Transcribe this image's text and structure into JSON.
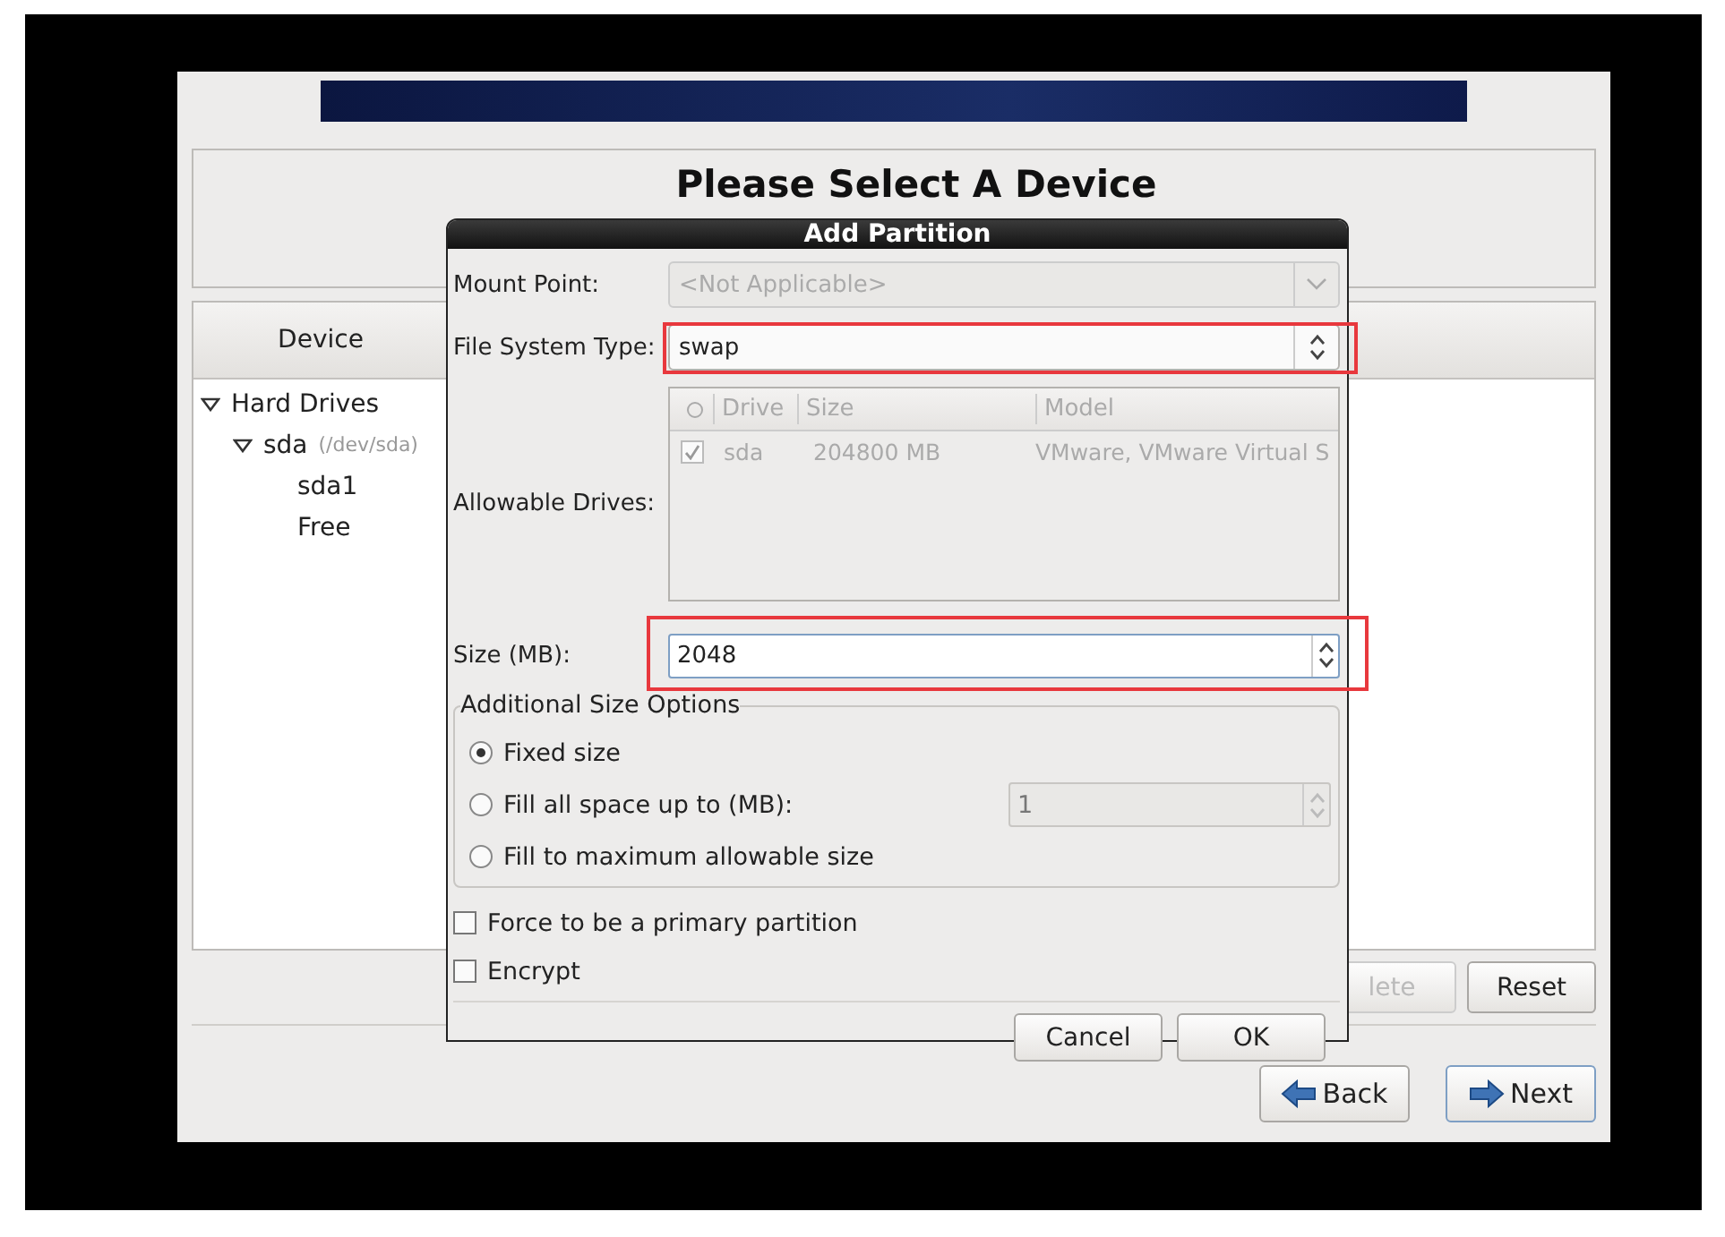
{
  "installer": {
    "heading": "Please Select A Device",
    "device_panel": {
      "column_header": "Device",
      "tree": [
        {
          "label": "Hard Drives",
          "expanded": true,
          "children": [
            {
              "label": "sda",
              "detail": "(/dev/sda)",
              "expanded": true,
              "children": [
                {
                  "label": "sda1"
                },
                {
                  "label": "Free"
                }
              ]
            }
          ]
        }
      ]
    },
    "panel_buttons": [
      {
        "label": "lete",
        "disabled": true
      },
      {
        "label": "Reset",
        "disabled": false
      }
    ],
    "nav_buttons": [
      {
        "label": "Back",
        "kind": "back"
      },
      {
        "label": "Next",
        "kind": "next"
      }
    ]
  },
  "dialog": {
    "title": "Add Partition",
    "mount_point": {
      "label": "Mount Point:",
      "value": "<Not Applicable>",
      "disabled": true
    },
    "file_system_type": {
      "label": "File System Type:",
      "value": "swap",
      "highlighted": true
    },
    "allowable_drives": {
      "label": "Allowable Drives:",
      "columns": [
        "Drive",
        "Size",
        "Model"
      ],
      "rows": [
        {
          "checked": true,
          "drive": "sda",
          "size": "204800 MB",
          "model": "VMware, VMware Virtual S"
        }
      ]
    },
    "size": {
      "label": "Size (MB):",
      "value": "2048",
      "highlighted": true
    },
    "size_options": {
      "title": "Additional Size Options",
      "options": [
        {
          "label": "Fixed size",
          "selected": true
        },
        {
          "label": "Fill all space up to (MB):",
          "selected": false,
          "field": {
            "value": "1",
            "disabled": true
          }
        },
        {
          "label": "Fill to maximum allowable size",
          "selected": false
        }
      ]
    },
    "checkboxes": [
      {
        "label": "Force to be a primary partition",
        "checked": false
      },
      {
        "label": "Encrypt",
        "checked": false
      }
    ],
    "buttons": [
      "Cancel",
      "OK"
    ]
  }
}
